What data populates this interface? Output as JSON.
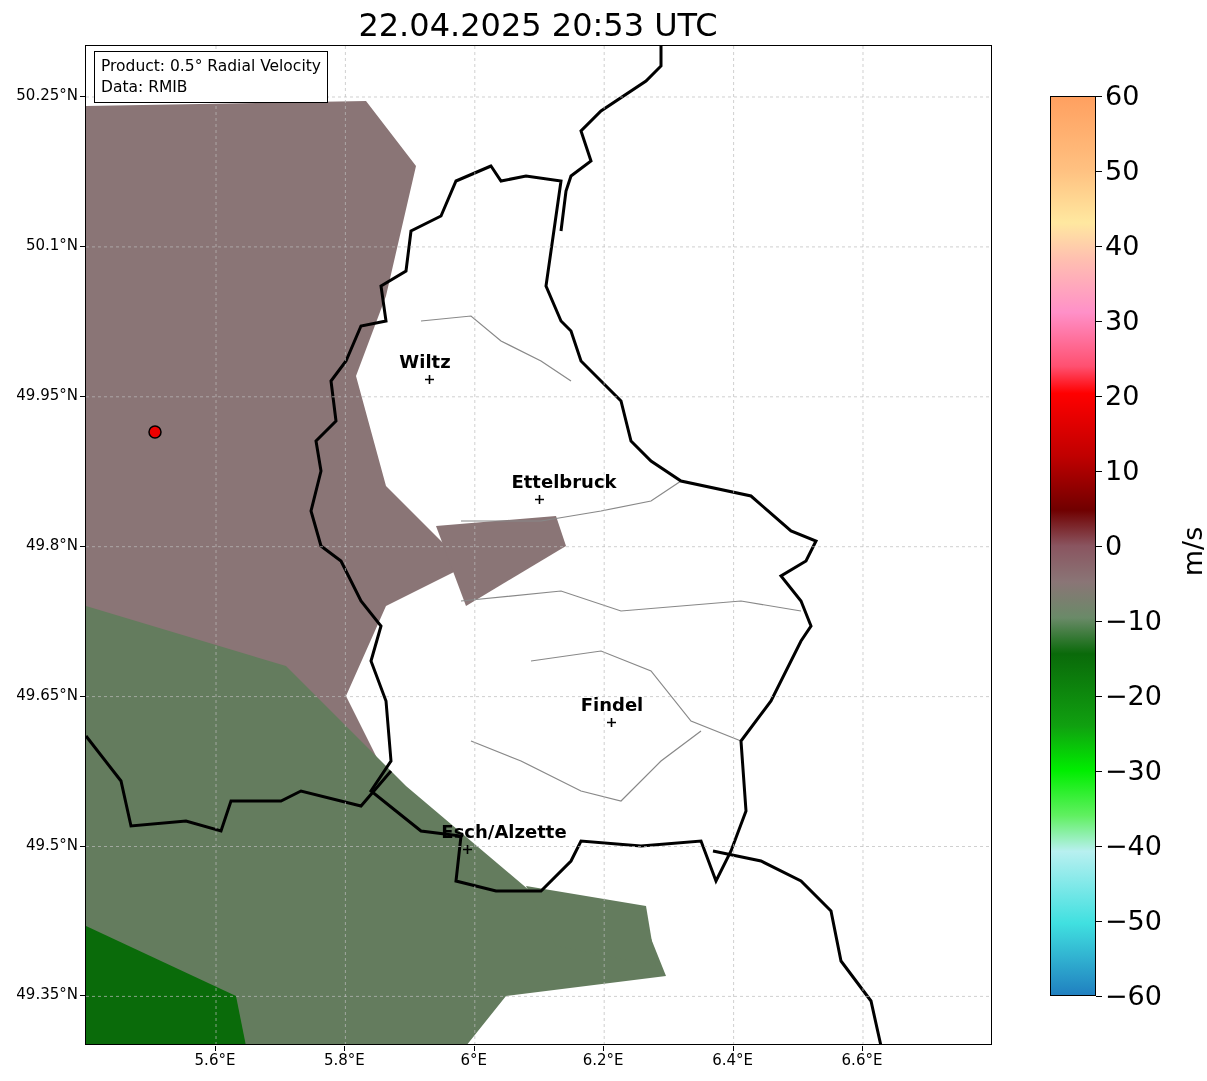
{
  "title": "22.04.2025 20:53 UTC",
  "info_box": {
    "lines": [
      "Product: 0.5° Radial Velocity",
      "Data: RMIB"
    ]
  },
  "latitude_ticks": [
    "50.25°N",
    "50.1°N",
    "49.95°N",
    "49.8°N",
    "49.65°N",
    "49.5°N",
    "49.35°N"
  ],
  "longitude_ticks": [
    "5.6°E",
    "5.8°E",
    "6°E",
    "6.2°E",
    "6.4°E",
    "6.6°E"
  ],
  "cities": [
    {
      "name": "Wiltz"
    },
    {
      "name": "Ettelbruck"
    },
    {
      "name": "Findel"
    },
    {
      "name": "Esch/Alzette"
    }
  ],
  "colorbar": {
    "label": "m/s",
    "ticks": [
      "60",
      "50",
      "40",
      "30",
      "20",
      "10",
      "0",
      "−10",
      "−20",
      "−30",
      "−40",
      "−50",
      "−60"
    ]
  }
}
